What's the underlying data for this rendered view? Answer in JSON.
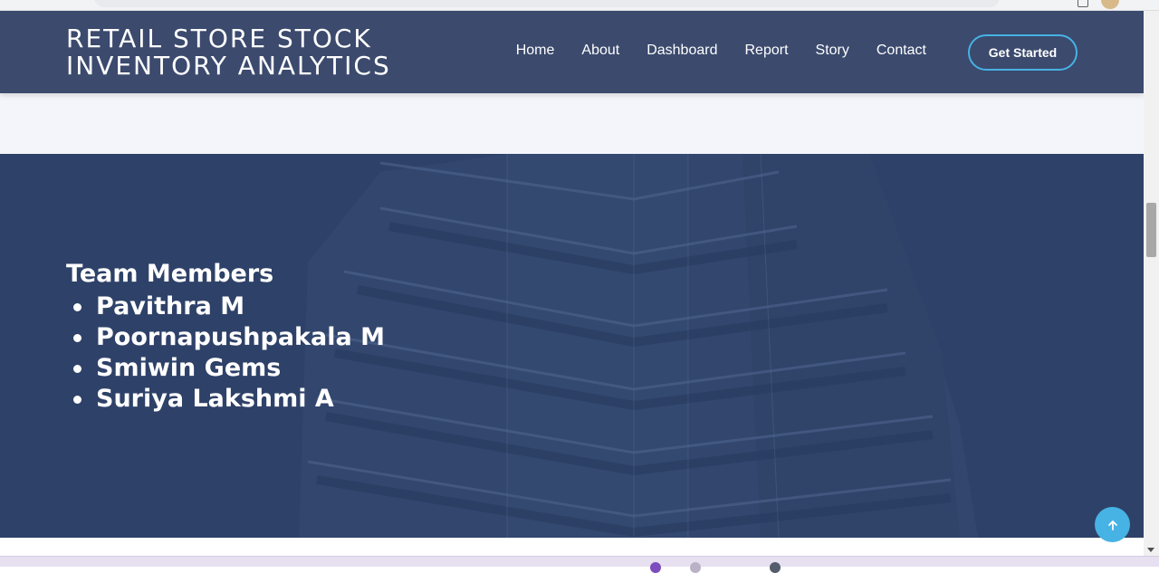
{
  "header": {
    "logo_line1": "RETAIL STORE STOCK",
    "logo_line2": "INVENTORY ANALYTICS",
    "nav": [
      {
        "label": "Home"
      },
      {
        "label": "About"
      },
      {
        "label": "Dashboard"
      },
      {
        "label": "Report"
      },
      {
        "label": "Story"
      },
      {
        "label": "Contact"
      }
    ],
    "cta_label": "Get Started"
  },
  "team": {
    "title": "Team Members",
    "members": [
      "Pavithra M",
      "Poornapushpakala M",
      "Smiwin Gems",
      "Suriya Lakshmi A"
    ]
  },
  "icons": {
    "back_to_top": "arrow-up-icon"
  },
  "colors": {
    "header_bg": "#3b4a6d",
    "section_bg": "#2e4168",
    "accent": "#47b2e4"
  }
}
